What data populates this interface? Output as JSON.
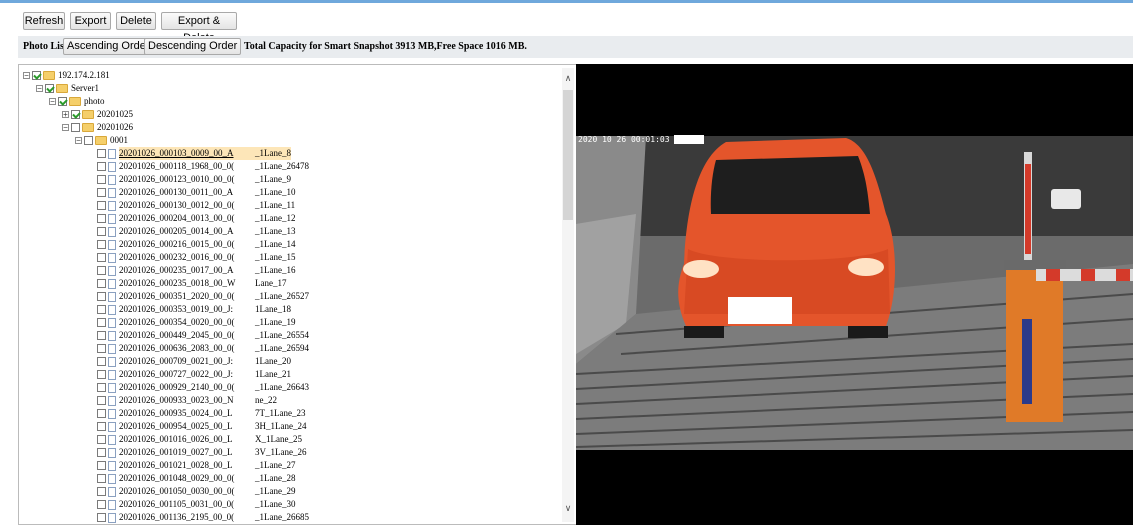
{
  "toolbar": {
    "refresh": "Refresh",
    "export": "Export",
    "delete": "Delete",
    "export_delete": "Export & Delete"
  },
  "photo_list": {
    "label": "Photo List",
    "ascending": "Ascending Order",
    "descending": "Descending Order",
    "capacity": "Total Capacity for Smart Snapshot 3913 MB,Free Space 1016 MB."
  },
  "tree": {
    "root": "192.174.2.181",
    "server": "Server1",
    "photo": "photo",
    "folder_a": "20201025",
    "folder_b": "20201026",
    "lane_folder": "0001",
    "files": [
      {
        "name": "20201026_000103_0009_00_A",
        "lane": "_1Lane_8"
      },
      {
        "name": "20201026_000118_1968_00_0(",
        "lane": "_1Lane_26478"
      },
      {
        "name": "20201026_000123_0010_00_0(",
        "lane": "_1Lane_9"
      },
      {
        "name": "20201026_000130_0011_00_A",
        "lane": "_1Lane_10"
      },
      {
        "name": "20201026_000130_0012_00_0(",
        "lane": "_1Lane_11"
      },
      {
        "name": "20201026_000204_0013_00_0(",
        "lane": "_1Lane_12"
      },
      {
        "name": "20201026_000205_0014_00_A",
        "lane": "_1Lane_13"
      },
      {
        "name": "20201026_000216_0015_00_0(",
        "lane": "_1Lane_14"
      },
      {
        "name": "20201026_000232_0016_00_0(",
        "lane": "_1Lane_15"
      },
      {
        "name": "20201026_000235_0017_00_A",
        "lane": "_1Lane_16"
      },
      {
        "name": "20201026_000235_0018_00_W",
        "lane": "Lane_17"
      },
      {
        "name": "20201026_000351_2020_00_0(",
        "lane": "_1Lane_26527"
      },
      {
        "name": "20201026_000353_0019_00_J:",
        "lane": "1Lane_18"
      },
      {
        "name": "20201026_000354_0020_00_0(",
        "lane": "_1Lane_19"
      },
      {
        "name": "20201026_000449_2045_00_0(",
        "lane": "_1Lane_26554"
      },
      {
        "name": "20201026_000636_2083_00_0(",
        "lane": "_1Lane_26594"
      },
      {
        "name": "20201026_000709_0021_00_J:",
        "lane": "1Lane_20"
      },
      {
        "name": "20201026_000727_0022_00_J:",
        "lane": "1Lane_21"
      },
      {
        "name": "20201026_000929_2140_00_0(",
        "lane": "_1Lane_26643"
      },
      {
        "name": "20201026_000933_0023_00_N",
        "lane": "ne_22"
      },
      {
        "name": "20201026_000935_0024_00_L",
        "lane": "7T_1Lane_23"
      },
      {
        "name": "20201026_000954_0025_00_L",
        "lane": "3H_1Lane_24"
      },
      {
        "name": "20201026_001016_0026_00_L",
        "lane": "X_1Lane_25"
      },
      {
        "name": "20201026_001019_0027_00_L",
        "lane": "3V_1Lane_26"
      },
      {
        "name": "20201026_001021_0028_00_L",
        "lane": "_1Lane_27"
      },
      {
        "name": "20201026_001048_0029_00_0(",
        "lane": "_1Lane_28"
      },
      {
        "name": "20201026_001050_0030_00_0(",
        "lane": "_1Lane_29"
      },
      {
        "name": "20201026_001105_0031_00_0(",
        "lane": "_1Lane_30"
      },
      {
        "name": "20201026_001136_2195_00_0(",
        "lane": "_1Lane_26685"
      }
    ]
  },
  "viewer": {
    "timestamp": "2020 10 26 00:01:03 A"
  },
  "colors": {
    "accent": "#6fa8dc",
    "car": "#e4552b",
    "barrier": "#e07a28"
  }
}
